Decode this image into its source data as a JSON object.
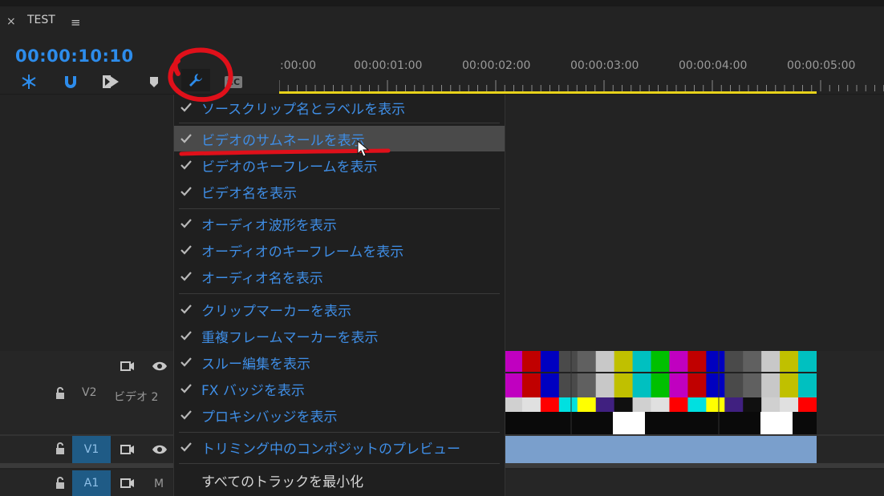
{
  "panel": {
    "close_glyph": "×",
    "title": "TEST",
    "menu_glyph": "≡",
    "timecode": "00:00:10:10"
  },
  "toolbar": {
    "tools": [
      {
        "name": "snap-icon",
        "label": "snap"
      },
      {
        "name": "magnet-icon",
        "label": "linked selection"
      },
      {
        "name": "add-marker-split-icon",
        "label": "insert"
      },
      {
        "name": "marker-icon",
        "label": "add marker"
      },
      {
        "name": "wrench-icon",
        "label": "timeline display settings"
      },
      {
        "name": "cc-icon",
        "label": "CC"
      }
    ],
    "cc_text": "CC"
  },
  "ruler": {
    "labels": [
      ":00:00",
      "00:00:01:00",
      "00:00:02:00",
      "00:00:03:00",
      "00:00:04:00",
      "00:00:05:00"
    ],
    "work_area_color": "#e8d21a"
  },
  "tracks": {
    "v2": {
      "id": "V2",
      "name": "ビデオ 2"
    },
    "v1": {
      "id": "V1"
    },
    "a1": {
      "id": "A1",
      "mute": "M"
    }
  },
  "menu": {
    "items": [
      {
        "label": "ソースクリップ名とラベルを表示",
        "checked": true
      },
      {
        "label": "ビデオのサムネールを表示",
        "checked": true,
        "highlighted": true
      },
      {
        "label": "ビデオのキーフレームを表示",
        "checked": true
      },
      {
        "label": "ビデオ名を表示",
        "checked": true
      },
      {
        "label": "オーディオ波形を表示",
        "checked": true
      },
      {
        "label": "オーディオのキーフレームを表示",
        "checked": true
      },
      {
        "label": "オーディオ名を表示",
        "checked": true
      },
      {
        "label": "クリップマーカーを表示",
        "checked": true
      },
      {
        "label": "重複フレームマーカーを表示",
        "checked": true
      },
      {
        "label": "スルー編集を表示",
        "checked": true
      },
      {
        "label": "FX バッジを表示",
        "checked": true
      },
      {
        "label": "プロキシバッジを表示",
        "checked": true
      },
      {
        "label": "トリミング中のコンポジットのプレビュー",
        "checked": true
      },
      {
        "label": "すべてのトラックを最小化",
        "checked": false
      }
    ]
  },
  "colors": {
    "accent": "#2d8ceb",
    "menu_text": "#3f8ee6",
    "annotation_red": "#e0101a",
    "clip_v1": "#7a9fcc"
  }
}
